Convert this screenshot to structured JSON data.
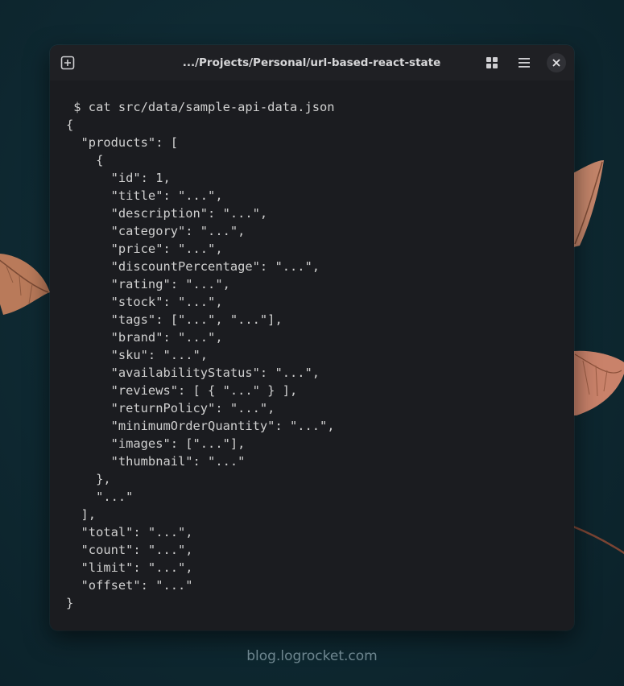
{
  "window": {
    "title": ".../Projects/Personal/url-based-react-state"
  },
  "toolbar": {
    "new_tab_icon": "new-tab-icon",
    "grid_icon": "grid-icon",
    "menu_icon": "hamburger-menu-icon",
    "close_icon": "close-icon"
  },
  "terminal": {
    "lines": [
      " $ cat src/data/sample-api-data.json",
      "{",
      "  \"products\": [",
      "    {",
      "      \"id\": 1,",
      "      \"title\": \"...\",",
      "      \"description\": \"...\",",
      "      \"category\": \"...\",",
      "      \"price\": \"...\",",
      "      \"discountPercentage\": \"...\",",
      "      \"rating\": \"...\",",
      "      \"stock\": \"...\",",
      "      \"tags\": [\"...\", \"...\"],",
      "      \"brand\": \"...\",",
      "      \"sku\": \"...\",",
      "      \"availabilityStatus\": \"...\",",
      "      \"reviews\": [ { \"...\" } ],",
      "      \"returnPolicy\": \"...\",",
      "      \"minimumOrderQuantity\": \"...\",",
      "      \"images\": [\"...\"],",
      "      \"thumbnail\": \"...\"",
      "    },",
      "    \"...\"",
      "  ],",
      "  \"total\": \"...\",",
      "  \"count\": \"...\",",
      "  \"limit\": \"...\",",
      "  \"offset\": \"...\"",
      "}"
    ]
  },
  "watermark": "blog.logrocket.com",
  "colors": {
    "background": "#0f2a33",
    "window": "#1b1c20",
    "titlebar": "#1f2024",
    "text": "#d0d0d0",
    "leaf": "#c98a6a"
  }
}
